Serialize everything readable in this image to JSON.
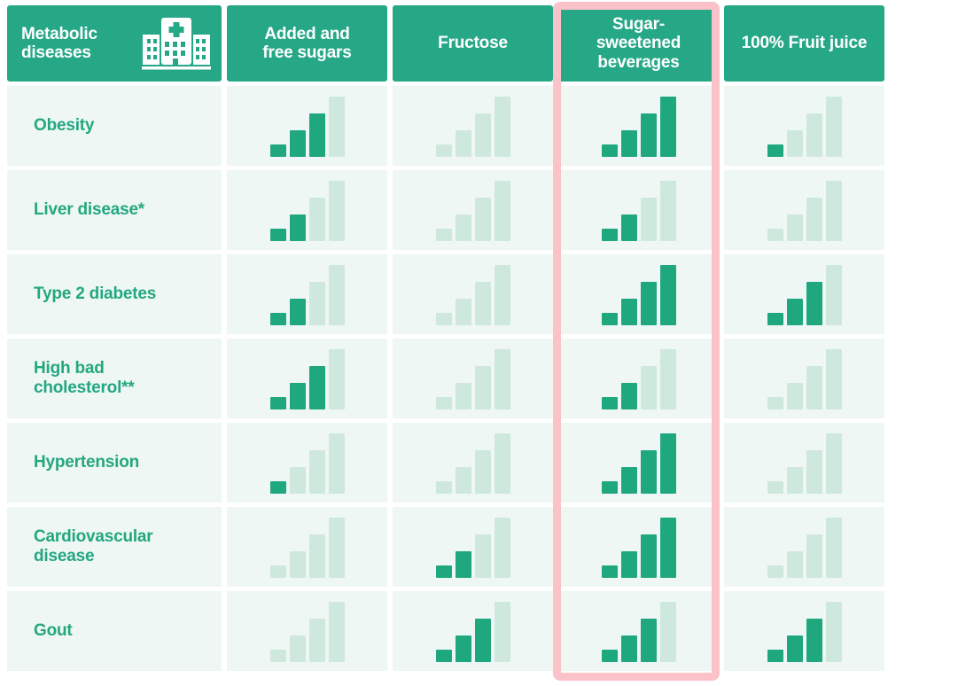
{
  "header": {
    "first_column_label": "Metabolic\ndiseases",
    "icon": "hospital-icon",
    "columns": [
      {
        "label": "Added and\nfree sugars",
        "highlighted": false
      },
      {
        "label": "Fructose",
        "highlighted": false
      },
      {
        "label": "Sugar-\nsweetened\nbeverages",
        "highlighted": true
      },
      {
        "label": "100% Fruit juice",
        "highlighted": false
      }
    ]
  },
  "colors": {
    "header_green": "#26a887",
    "bar_filled": "#1fa87e",
    "bar_empty": "#cfe8dd",
    "cell_background": "#eef7f3",
    "label_text": "#24a77f",
    "highlight_pink": "#fcc2ca",
    "page_background": "#ffffff"
  },
  "chart_data": {
    "type": "heatmap",
    "title": "Metabolic diseases",
    "xlabel": "",
    "ylabel": "",
    "scale_levels": 4,
    "scale_note": "Each cell shows 4 ascending bars; the number of dark-green filled bars encodes the strength of evidence (0 = none, 4 = strongest).",
    "categories": [
      "Added and free sugars",
      "Fructose",
      "Sugar-sweetened beverages",
      "100% Fruit juice"
    ],
    "rows": [
      {
        "label": "Obesity",
        "values": [
          3,
          0,
          4,
          1
        ]
      },
      {
        "label": "Liver disease*",
        "values": [
          2,
          0,
          2,
          0
        ]
      },
      {
        "label": "Type 2 diabetes",
        "values": [
          2,
          0,
          4,
          3
        ]
      },
      {
        "label": "High bad\ncholesterol**",
        "values": [
          3,
          0,
          2,
          0
        ]
      },
      {
        "label": "Hypertension",
        "values": [
          1,
          0,
          4,
          0
        ]
      },
      {
        "label": "Cardiovascular\ndisease",
        "values": [
          0,
          2,
          4,
          0
        ]
      },
      {
        "label": "Gout",
        "values": [
          0,
          3,
          3,
          3
        ]
      }
    ]
  }
}
